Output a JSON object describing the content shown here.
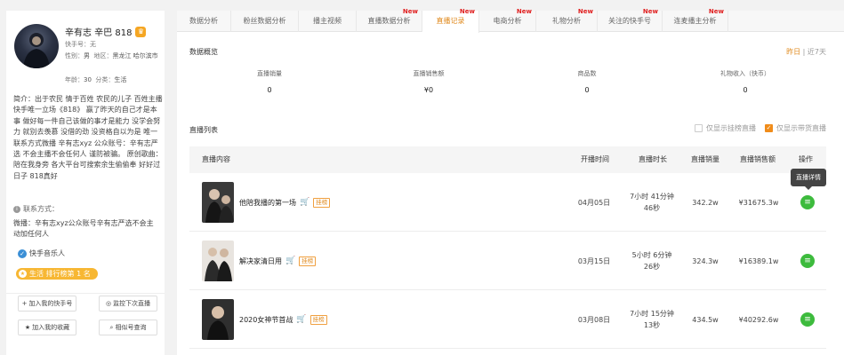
{
  "profile": {
    "name": "辛有志 辛巴 818",
    "kuaishou_id": "快手号：无",
    "gender_label": "性别：",
    "gender": "男",
    "region_label": "地区：",
    "region": "黑龙江 哈尔滨市",
    "age_label": "年龄：",
    "age": "30",
    "category_label": "分类：",
    "category": "生活",
    "bio": "简介：出于农民 情于百姓 农民的儿子 百姓主播 快手唯一立场《818》 赢了昨天的自己才是本事 做好每一件自己该做的事才是能力 没学会努力 就别去羡慕 没借的劲 没资格自以为是 唯一联系方式微播 辛有志xyz 公众账号：辛有志严选 不会主播不会任何人 谨防被骗。 原创歌曲： 陪在我身旁 各大平台可搜索余生偷偷奉 好好过日子 818真好",
    "contact_label": "联系方式：",
    "contact": "微播：辛有志xyz公众账号辛有志严选不会主动加任何人",
    "verified_tag": "快手音乐人",
    "rank_badge": "生活 排行榜第 1 名",
    "buttons": {
      "add_mine": "加入我的快手号",
      "monitor": "监控下次直播",
      "add_fav": "加入我的收藏",
      "similar": "相似号查询"
    }
  },
  "tabs": [
    {
      "label": "数据分析",
      "new": ""
    },
    {
      "label": "粉丝数据分析",
      "new": ""
    },
    {
      "label": "播主视频",
      "new": ""
    },
    {
      "label": "直播数据分析",
      "new": "New"
    },
    {
      "label": "直播记录",
      "new": "New"
    },
    {
      "label": "电商分析",
      "new": "New"
    },
    {
      "label": "礼物分析",
      "new": "New"
    },
    {
      "label": "关注的快手号",
      "new": "New"
    },
    {
      "label": "连麦播主分析",
      "new": "New"
    }
  ],
  "overview": {
    "title": "数据概览",
    "range_yesterday": "昨日",
    "range_sep": "|",
    "range_7days": "近7天",
    "stats": [
      {
        "label": "直播销量",
        "value": "0"
      },
      {
        "label": "直播销售额",
        "value": "¥0"
      },
      {
        "label": "商品数",
        "value": "0"
      },
      {
        "label": "礼物收入（快币）",
        "value": "0"
      }
    ]
  },
  "list": {
    "title": "直播列表",
    "option_hanging": "仅显示挂榜直播",
    "option_goods": "仅显示带货直播",
    "headers": {
      "content": "直播内容",
      "start": "开播时间",
      "duration": "直播时长",
      "sales": "直播销量",
      "revenue": "直播销售额",
      "action": "操作"
    },
    "rows": [
      {
        "title": "他陪我播的第一场",
        "tag": "挂榜",
        "date": "04月05日",
        "duration": "7小时 41分钟",
        "seconds": "46秒",
        "sales": "342.2w",
        "revenue": "¥31675.3w"
      },
      {
        "title": "解决家清日用",
        "tag": "挂榜",
        "date": "03月15日",
        "duration": "5小时 6分钟",
        "seconds": "26秒",
        "sales": "324.3w",
        "revenue": "¥16389.1w"
      },
      {
        "title": "2020女神节首战",
        "tag": "挂榜",
        "date": "03月08日",
        "duration": "7小时 15分钟",
        "seconds": "13秒",
        "sales": "434.5w",
        "revenue": "¥40292.6w"
      }
    ],
    "tooltip": "直播详情"
  },
  "colors": {
    "accent": "#e08a1e",
    "new_badge": "#e02020",
    "detail_button": "#3dbb3d",
    "rank_badge": "#f7b733"
  }
}
